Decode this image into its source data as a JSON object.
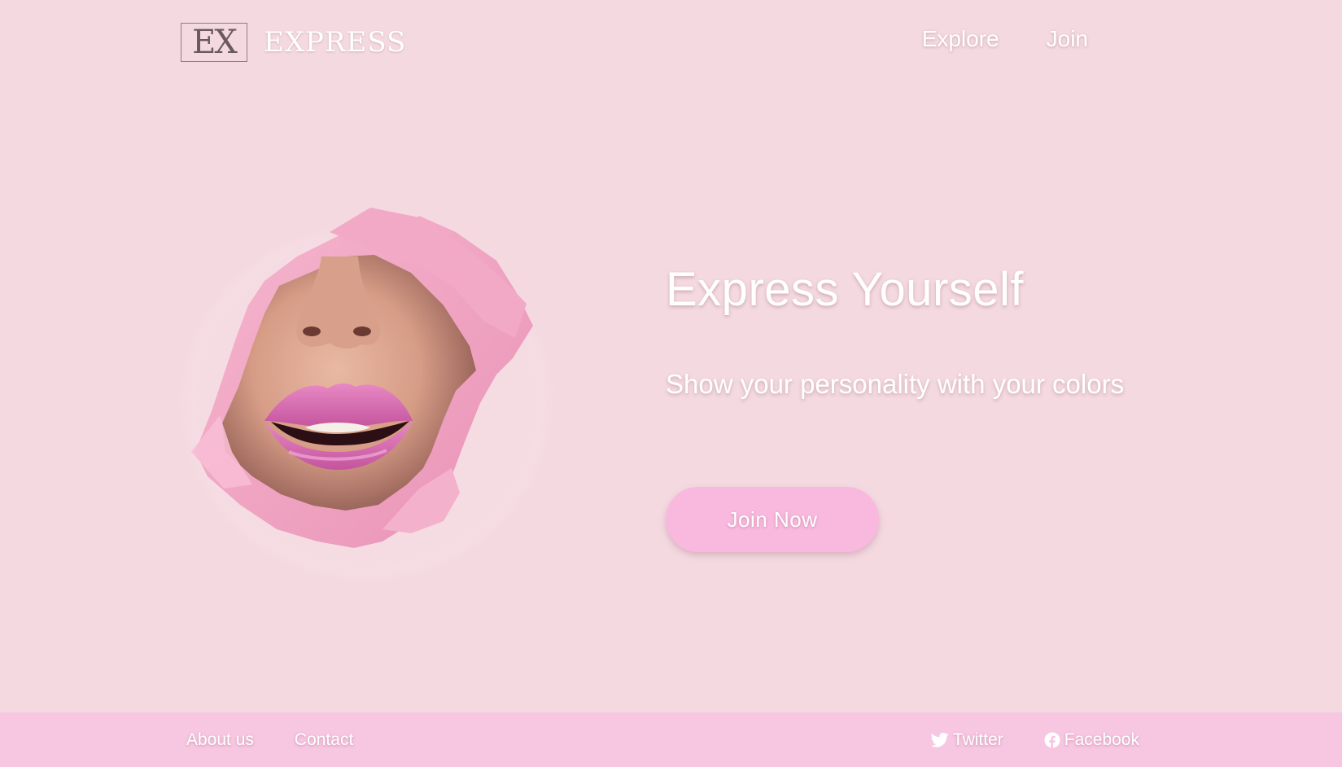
{
  "brand": {
    "monogram": "EX",
    "name": "EXPRESS"
  },
  "nav": {
    "explore": "Explore",
    "join": "Join"
  },
  "hero": {
    "title": "Express Yourself",
    "subtitle": "Show your personality with your colors",
    "cta_label": "Join Now",
    "image_icon": "torn-paper-lips-image"
  },
  "footer": {
    "about": "About us",
    "contact": "Contact",
    "twitter": {
      "label": "Twitter",
      "icon": "twitter-icon"
    },
    "facebook": {
      "label": "Facebook",
      "icon": "facebook-icon"
    }
  },
  "colors": {
    "background": "#f4d9e0",
    "footer_bg": "#f7c6e1",
    "button_bg": "#f9b8dd",
    "text": "#ffffff"
  }
}
